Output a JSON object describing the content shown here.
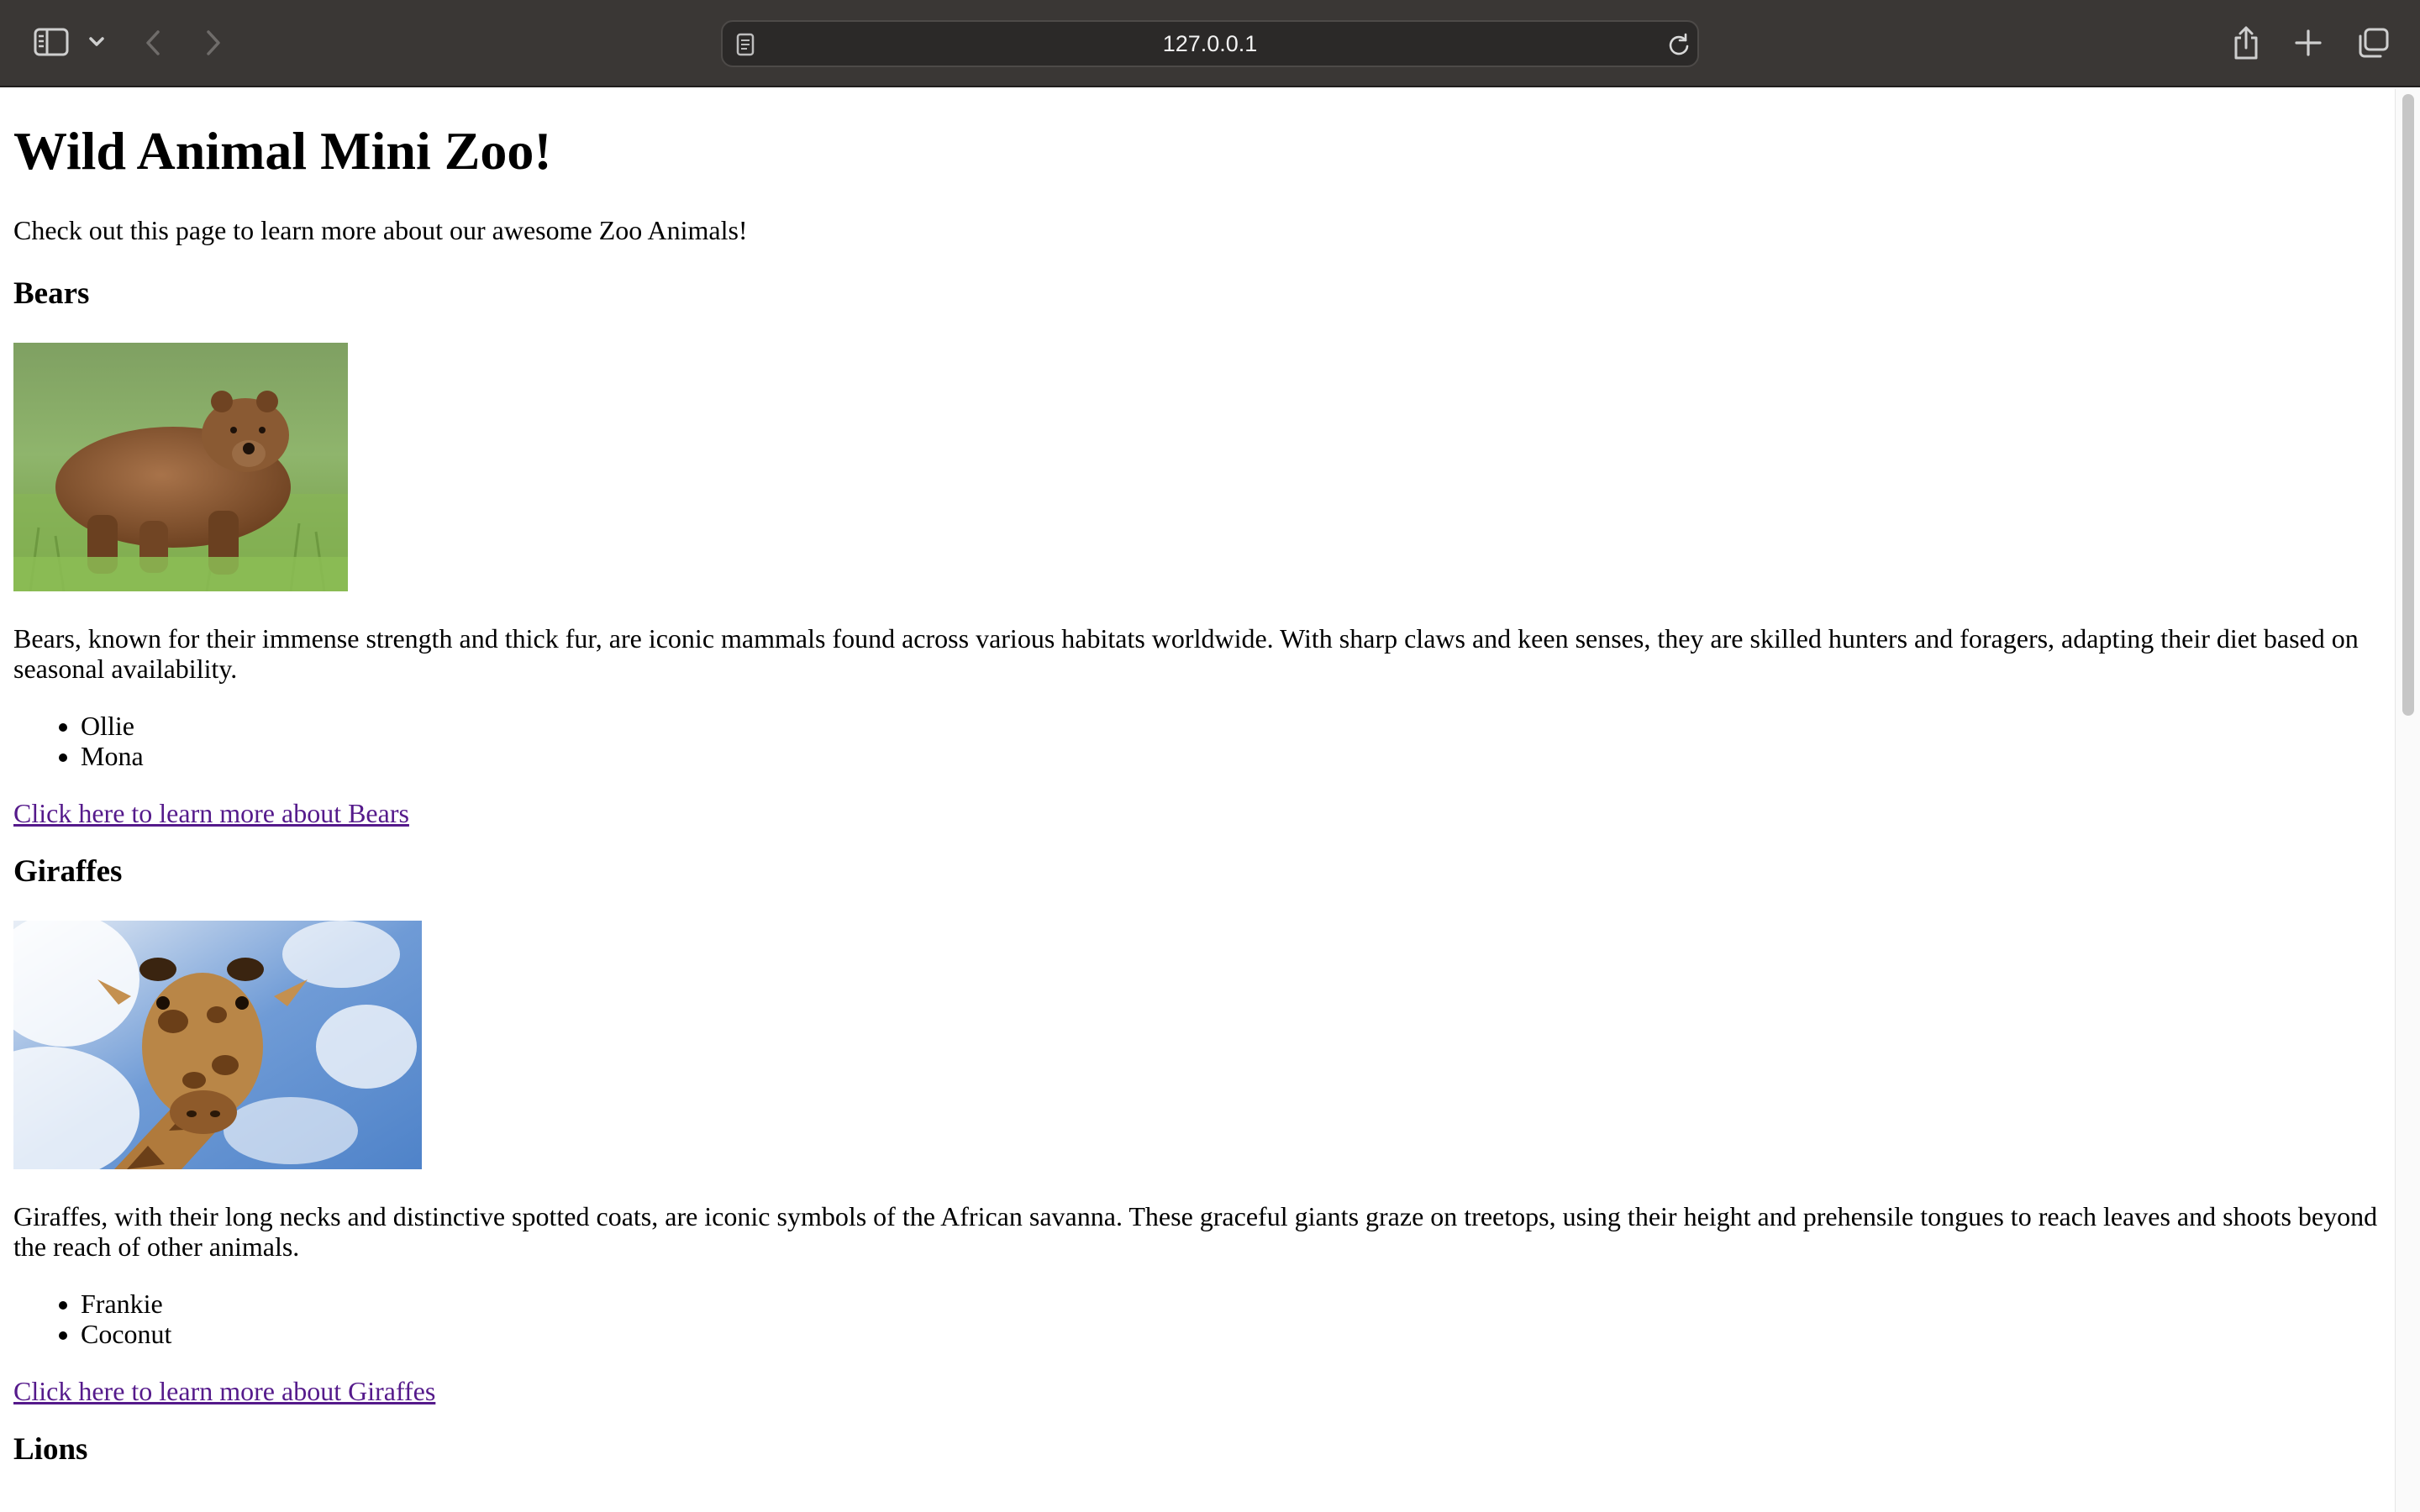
{
  "browser": {
    "url": "127.0.0.1",
    "icons": {
      "sidebar": "sidebar-icon",
      "tab_group_menu": "chevron-down-icon",
      "back": "back-arrow-icon",
      "forward": "forward-arrow-icon",
      "page_info": "page-icon",
      "reload": "reload-icon",
      "share": "share-icon",
      "new_tab": "plus-icon",
      "tab_overview": "tabs-icon"
    }
  },
  "page": {
    "title": "Wild Animal Mini Zoo!",
    "intro": "Check out this page to learn more about our awesome Zoo Animals!",
    "sections": [
      {
        "heading": "Bears",
        "image": "brown bear standing in green grass",
        "description": "Bears, known for their immense strength and thick fur, are iconic mammals found across various habitats worldwide. With sharp claws and keen senses, they are skilled hunters and foragers, adapting their diet based on seasonal availability.",
        "names": [
          "Ollie",
          "Mona"
        ],
        "link": "Click here to learn more about Bears"
      },
      {
        "heading": "Giraffes",
        "image": "giraffe head against blue sky",
        "description": "Giraffes, with their long necks and distinctive spotted coats, are iconic symbols of the African savanna. These graceful giants graze on treetops, using their height and prehensile tongues to reach leaves and shoots beyond the reach of other animals.",
        "names": [
          "Frankie",
          "Coconut"
        ],
        "link": "Click here to learn more about Giraffes"
      },
      {
        "heading": "Lions"
      }
    ]
  },
  "colors": {
    "toolbar_bg": "#3a3735",
    "link_visited": "#551a8b"
  }
}
